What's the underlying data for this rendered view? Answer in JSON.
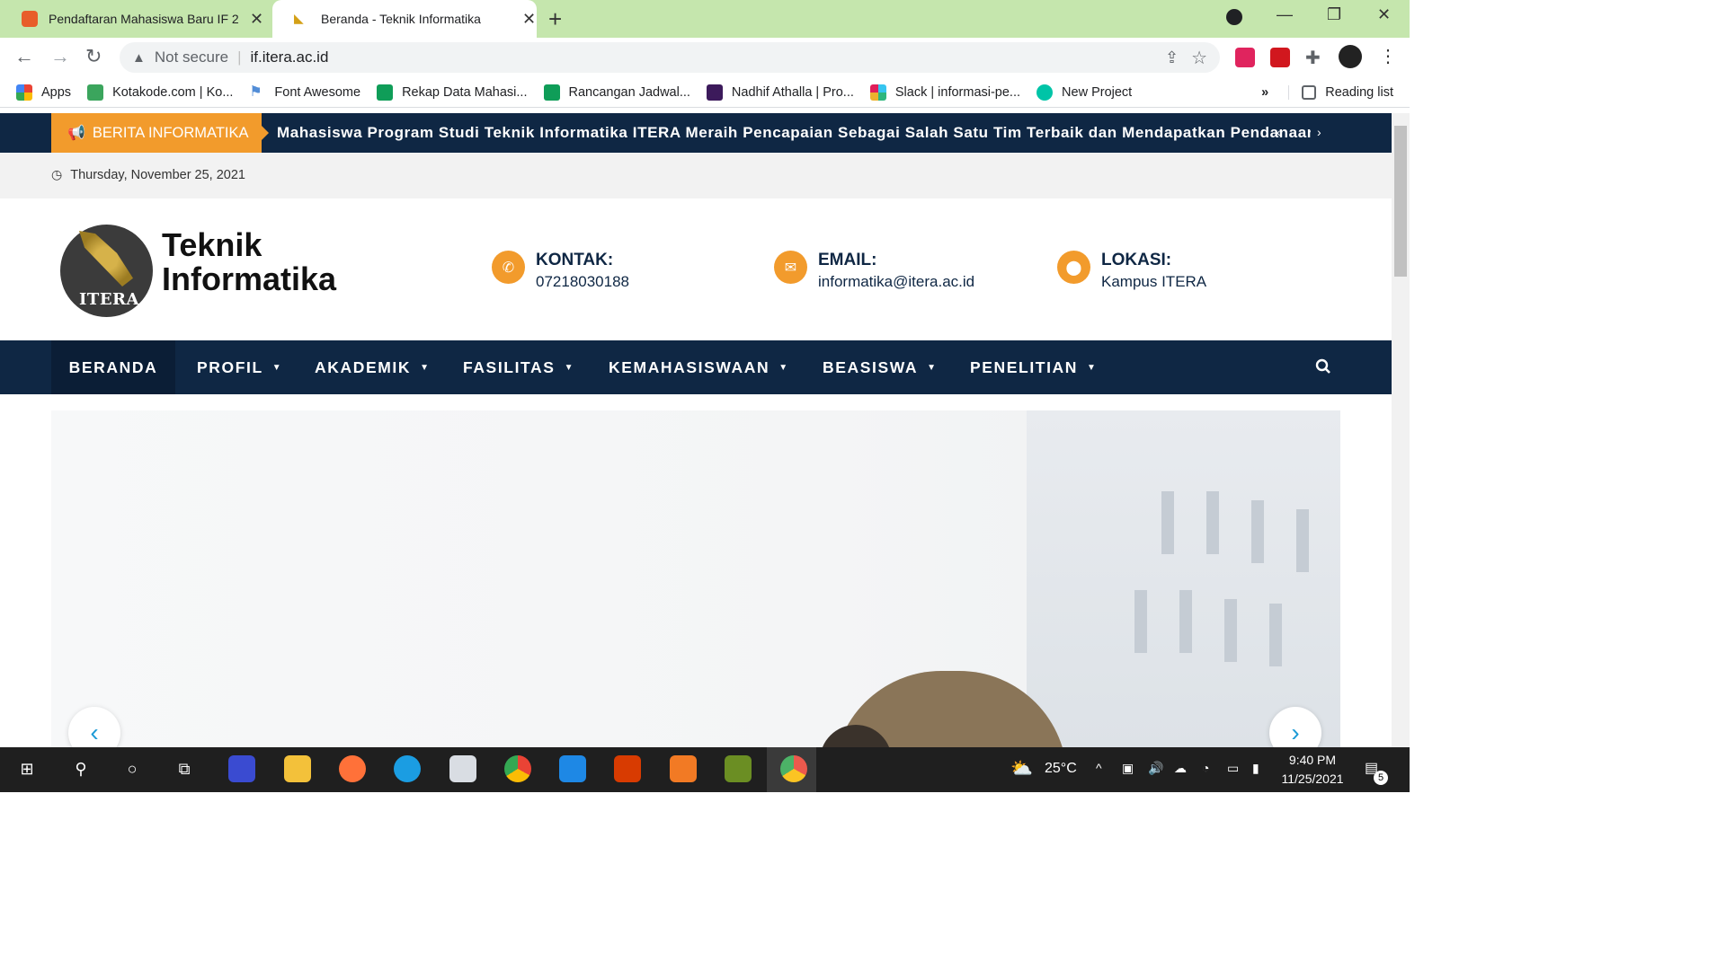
{
  "browser": {
    "tabs": [
      {
        "title": "Pendaftaran Mahasiswa Baru IF 2",
        "favicon_color": "#e85d2a"
      },
      {
        "title": "Beranda - Teknik Informatika",
        "favicon_color": "#d4a017"
      }
    ],
    "address": {
      "security": "Not secure",
      "url": "if.itera.ac.id"
    },
    "bookmarks": [
      {
        "label": "Apps",
        "icon": "apps-grid-icon"
      },
      {
        "label": "Kotakode.com | Ko...",
        "icon": "kotakode-icon"
      },
      {
        "label": "Font Awesome",
        "icon": "flag-icon"
      },
      {
        "label": "Rekap Data Mahasi...",
        "icon": "sheets-icon"
      },
      {
        "label": "Rancangan Jadwal...",
        "icon": "sheets-icon"
      },
      {
        "label": "Nadhif Athalla | Pro...",
        "icon": "p-icon"
      },
      {
        "label": "Slack | informasi-pe...",
        "icon": "slack-icon"
      },
      {
        "label": "New Project",
        "icon": "project-icon"
      }
    ],
    "more_bookmarks": "»",
    "reading_list": "Reading list"
  },
  "site": {
    "ticker": {
      "label": "BERITA INFORMATIKA",
      "text": "Mahasiswa Program Studi Teknik Informatika ITERA Meraih Pencapaian Sebagai Salah Satu Tim Terbaik dan Mendapatkan Pendanaan Proyek"
    },
    "date": "Thursday, November 25, 2021",
    "logo": {
      "line1": "Teknik",
      "line2": "Informatika",
      "badge": "ITERA"
    },
    "contacts": [
      {
        "heading": "KONTAK:",
        "value": "07218030188",
        "icon": "phone-icon"
      },
      {
        "heading": "EMAIL:",
        "value": "informatika@itera.ac.id",
        "icon": "envelope-icon"
      },
      {
        "heading": "LOKASI:",
        "value": "Kampus ITERA",
        "icon": "map-pin-icon"
      }
    ],
    "menu": [
      {
        "label": "BERANDA",
        "dropdown": false
      },
      {
        "label": "PROFIL",
        "dropdown": true
      },
      {
        "label": "AKADEMIK",
        "dropdown": true
      },
      {
        "label": "FASILITAS",
        "dropdown": true
      },
      {
        "label": "KEMAHASISWAAN",
        "dropdown": true
      },
      {
        "label": "BEASISWA",
        "dropdown": true
      },
      {
        "label": "PENELITIAN",
        "dropdown": true
      }
    ],
    "colors": {
      "navy": "#0f2744",
      "orange": "#f29b2c",
      "accent_blue": "#1d9bd6"
    }
  },
  "taskbar": {
    "weather": "25°C",
    "time": "9:40 PM",
    "date": "11/25/2021",
    "notifications": "5"
  }
}
